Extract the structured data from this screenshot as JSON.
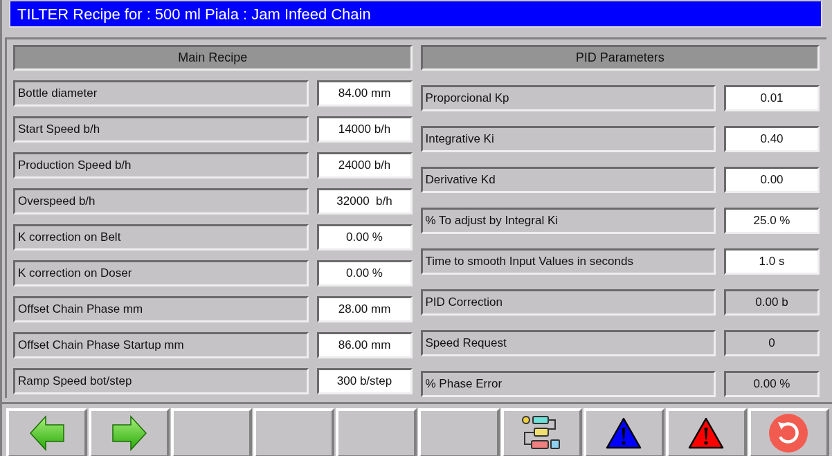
{
  "title": "TILTER Recipe for : 500 ml Piala : Jam Infeed Chain",
  "main_recipe": {
    "heading": "Main Recipe",
    "rows": [
      {
        "label": "Bottle diameter",
        "value": "84.00 mm",
        "kind": "input"
      },
      {
        "label": "Start Speed b/h",
        "value": "14000 b/h",
        "kind": "input"
      },
      {
        "label": "Production Speed b/h",
        "value": "24000 b/h",
        "kind": "input"
      },
      {
        "label": "Overspeed b/h",
        "value": "32000  b/h",
        "kind": "input"
      },
      {
        "label": "K correction on Belt",
        "value": "0.00 %",
        "kind": "input"
      },
      {
        "label": "K correction on Doser",
        "value": "0.00 %",
        "kind": "input"
      },
      {
        "label": "Offset Chain Phase mm",
        "value": "28.00 mm",
        "kind": "input"
      },
      {
        "label": "Offset Chain Phase Startup mm",
        "value": "86.00 mm",
        "kind": "input"
      },
      {
        "label": "Ramp Speed bot/step",
        "value": "300 b/step",
        "kind": "input"
      }
    ]
  },
  "pid_parameters": {
    "heading": "PID Parameters",
    "rows": [
      {
        "label": "Proporcional Kp",
        "value": "0.01",
        "kind": "input"
      },
      {
        "label": "Integrative Ki",
        "value": "0.40",
        "kind": "input"
      },
      {
        "label": "Derivative Kd",
        "value": "0.00",
        "kind": "input"
      },
      {
        "label": "% To adjust by Integral Ki",
        "value": "25.0 %",
        "kind": "input"
      },
      {
        "label": "Time to smooth Input Values in seconds",
        "value": "1.0 s",
        "kind": "input"
      },
      {
        "label": "PID Correction",
        "value": "0.00 b",
        "kind": "display"
      },
      {
        "label": "Speed Request",
        "value": "0",
        "kind": "display"
      },
      {
        "label": "% Phase Error",
        "value": "0.00 %",
        "kind": "display"
      }
    ]
  },
  "toolbar": [
    {
      "kind": "prev"
    },
    {
      "kind": "next"
    },
    {
      "kind": "empty"
    },
    {
      "kind": "empty"
    },
    {
      "kind": "empty"
    },
    {
      "kind": "empty"
    },
    {
      "kind": "flow"
    },
    {
      "kind": "alarm",
      "color": "#0000ff"
    },
    {
      "kind": "alarm",
      "color": "#ff0000"
    },
    {
      "kind": "back"
    }
  ]
}
